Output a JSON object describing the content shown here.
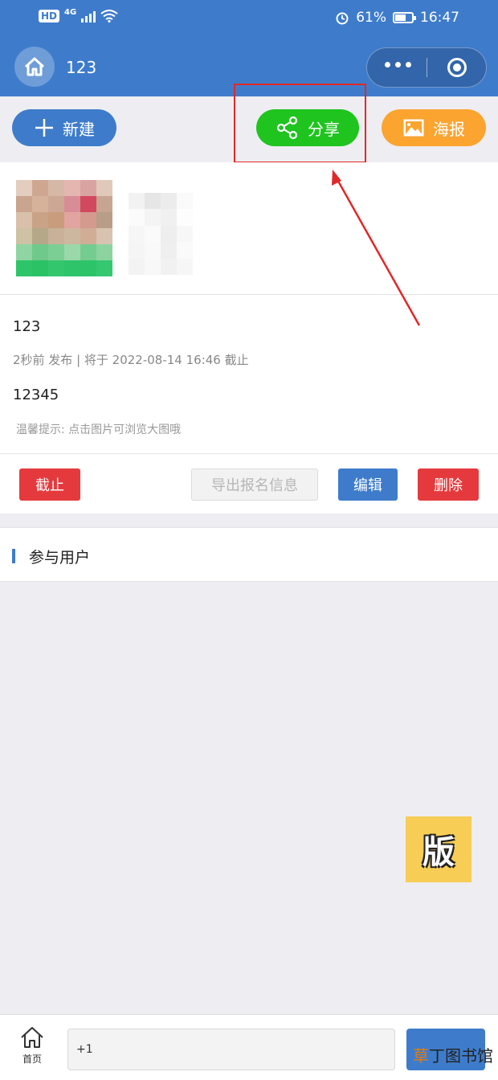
{
  "status_bar": {
    "hd": "HD",
    "network": "4G",
    "battery": "61%",
    "time": "16:47"
  },
  "nav": {
    "title": "123"
  },
  "actions": {
    "new_label": "新建",
    "share_label": "分享",
    "poster_label": "海报"
  },
  "post": {
    "title": "123",
    "meta": "2秒前 发布  |  将于 2022-08-14 16:46 截止",
    "description": "12345",
    "tip": "温馨提示: 点击图片可浏览大图哦"
  },
  "buttons": {
    "stop": "截止",
    "export": "导出报名信息",
    "edit": "编辑",
    "delete": "删除"
  },
  "participants": {
    "title": "参与用户"
  },
  "float_badge": {
    "text": "版"
  },
  "bottom": {
    "home_label": "首页",
    "comment_value": "+1"
  },
  "watermark": {
    "accent": "草",
    "rest": "丁图书馆"
  },
  "colors": {
    "primary": "#3e7ccb",
    "share": "#1fc41f",
    "poster": "#fba430",
    "danger": "#e53a3d",
    "highlight": "#e02828"
  }
}
